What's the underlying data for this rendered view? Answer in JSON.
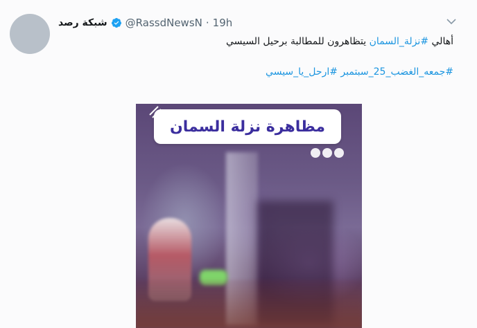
{
  "tweet": {
    "display_name": "شبكة رصد",
    "handle": "@RassdNewsN",
    "separator": "·",
    "time": "19h",
    "text_prefix": "أهالي ",
    "text_hashtag": "#نزلة_السمان",
    "text_suffix": " يتظاهرون للمطالبة برحيل السيسي",
    "hashtags_line": "#جمعه_الغضب_25_سبتمبر #ارحل_يا_سيسي"
  },
  "media": {
    "caption": "مظاهرة نزلة السمان"
  },
  "icons": {
    "verified": "verified-badge-icon",
    "menu": "chevron-down-icon"
  },
  "colors": {
    "link": "#1b95e0",
    "verified": "#1da1f2",
    "caption_text": "#3b2e9e"
  }
}
